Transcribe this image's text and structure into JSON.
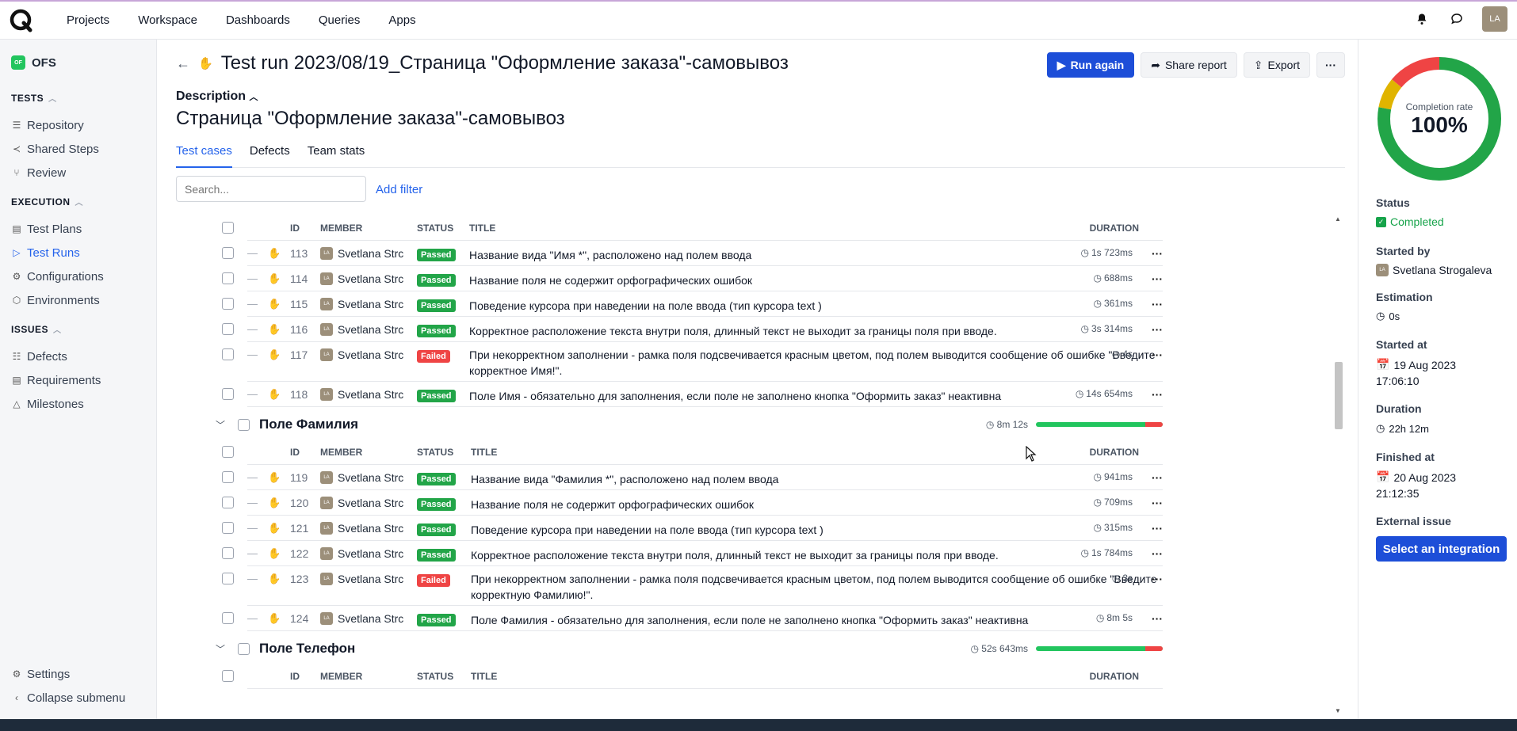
{
  "topnav": {
    "items": [
      "Projects",
      "Workspace",
      "Dashboards",
      "Queries",
      "Apps"
    ],
    "avatar": "LA"
  },
  "sidebar": {
    "project_badge": "OF",
    "project": "OFS",
    "sections": [
      {
        "title": "TESTS",
        "items": [
          "Repository",
          "Shared Steps",
          "Review"
        ]
      },
      {
        "title": "EXECUTION",
        "items": [
          "Test Plans",
          "Test Runs",
          "Configurations",
          "Environments"
        ]
      },
      {
        "title": "ISSUES",
        "items": [
          "Defects",
          "Requirements",
          "Milestones"
        ]
      }
    ],
    "settings": "Settings",
    "collapse": "Collapse submenu"
  },
  "header": {
    "title": "Test run 2023/08/19_Страница \"Оформление заказа\"-самовывоз",
    "run_again": "Run again",
    "share": "Share report",
    "export": "Export"
  },
  "description": {
    "label": "Description",
    "text": "Страница \"Оформление заказа\"-самовывоз"
  },
  "tabs": [
    "Test cases",
    "Defects",
    "Team stats"
  ],
  "search": {
    "placeholder": "Search..."
  },
  "add_filter": "Add filter",
  "columns": {
    "id": "ID",
    "member": "MEMBER",
    "status": "STATUS",
    "title": "TITLE",
    "duration": "DURATION"
  },
  "group1": {
    "rows": [
      {
        "id": "113",
        "member": "Svetlana Strc",
        "status": "Passed",
        "title": "Название вида \"Имя *\", расположено над полем ввода",
        "duration": "1s 723ms"
      },
      {
        "id": "114",
        "member": "Svetlana Strc",
        "status": "Passed",
        "title": "Название поля не содержит орфографических ошибок",
        "duration": "688ms"
      },
      {
        "id": "115",
        "member": "Svetlana Strc",
        "status": "Passed",
        "title": "Поведение курсора при наведении на поле ввода (тип курсора text )",
        "duration": "361ms"
      },
      {
        "id": "116",
        "member": "Svetlana Strc",
        "status": "Passed",
        "title": "Корректное расположение текста внутри поля, длинный текст не выходит за границы поля при вводе.",
        "duration": "3s 314ms"
      },
      {
        "id": "117",
        "member": "Svetlana Strc",
        "status": "Failed",
        "title": "При некорректном заполнении - рамка поля подсвечивается красным цветом, под полем выводится сообщение об ошибке \"Введите корректное Имя!\".",
        "duration": "4s"
      },
      {
        "id": "118",
        "member": "Svetlana Strc",
        "status": "Passed",
        "title": "Поле Имя - обязательно для заполнения, если поле не заполнено кнопка \"Оформить заказ\" неактивна",
        "duration": "14s 654ms"
      }
    ]
  },
  "group2": {
    "name": "Поле Фамилия",
    "duration": "8m 12s",
    "failed_fraction": 0.14,
    "rows": [
      {
        "id": "119",
        "member": "Svetlana Strc",
        "status": "Passed",
        "title": "Название вида \"Фамилия *\", расположено над полем ввода",
        "duration": "941ms"
      },
      {
        "id": "120",
        "member": "Svetlana Strc",
        "status": "Passed",
        "title": "Название поля не содержит орфографических ошибок",
        "duration": "709ms"
      },
      {
        "id": "121",
        "member": "Svetlana Strc",
        "status": "Passed",
        "title": "Поведение курсора при наведении на поле ввода (тип курсора text )",
        "duration": "315ms"
      },
      {
        "id": "122",
        "member": "Svetlana Strc",
        "status": "Passed",
        "title": "Корректное расположение текста внутри поля, длинный текст не выходит за границы поля при вводе.",
        "duration": "1s 784ms"
      },
      {
        "id": "123",
        "member": "Svetlana Strc",
        "status": "Failed",
        "title": "При некорректном заполнении - рамка поля подсвечивается красным цветом, под полем выводится сообщение об ошибке \"Введите корректную Фамилию!\".",
        "duration": "3s"
      },
      {
        "id": "124",
        "member": "Svetlana Strc",
        "status": "Passed",
        "title": "Поле Фамилия - обязательно для заполнения, если поле не заполнено кнопка \"Оформить заказ\" неактивна",
        "duration": "8m 5s"
      }
    ]
  },
  "group3": {
    "name": "Поле Телефон",
    "duration": "52s 643ms",
    "failed_fraction": 0.14
  },
  "summary": {
    "completion_label": "Completion rate",
    "completion_value": "100%",
    "donut_shares": {
      "passed": 0.78,
      "skipped": 0.08,
      "failed": 0.14
    },
    "status_label": "Status",
    "status": "Completed",
    "started_by_label": "Started by",
    "started_by": "Svetlana Strogaleva",
    "estimation_label": "Estimation",
    "estimation": "0s",
    "started_at_label": "Started at",
    "started_at_date": "19 Aug 2023",
    "started_at_time": "17:06:10",
    "duration_label": "Duration",
    "duration": "22h 12m",
    "finished_at_label": "Finished at",
    "finished_at_date": "20 Aug 2023",
    "finished_at_time": "21:12:35",
    "external_label": "External issue",
    "external_button": "Select an integration"
  },
  "colors": {
    "accent": "#1d4ed8",
    "passed": "#22a548",
    "failed": "#ef4444",
    "skipped": "#e0b400"
  }
}
